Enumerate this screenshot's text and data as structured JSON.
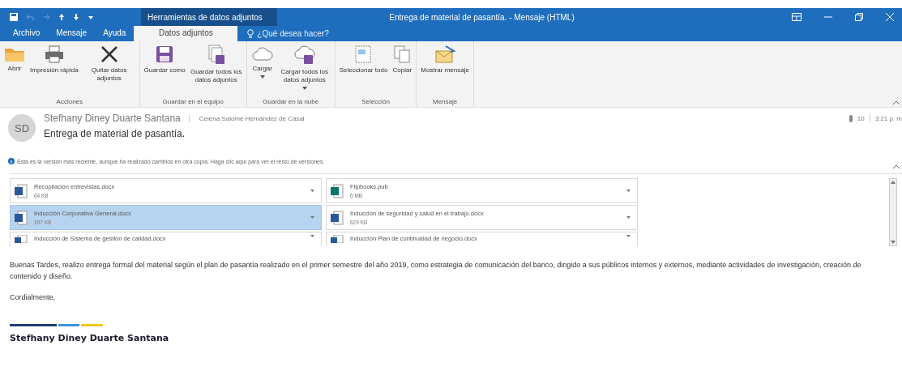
{
  "window": {
    "contextual_group": "Herramientas de datos adjuntos",
    "title": "Entrega de material de pasantía. - Mensaje (HTML)"
  },
  "tabs": [
    {
      "label": "Archivo",
      "selected": false
    },
    {
      "label": "Mensaje",
      "selected": false
    },
    {
      "label": "Ayuda",
      "selected": false
    },
    {
      "label": "Datos adjuntos",
      "selected": true
    }
  ],
  "tell_me": {
    "placeholder": "¿Qué desea hacer?"
  },
  "ribbon": [
    {
      "group": "Acciones",
      "buttons": [
        {
          "label": "Abrir"
        },
        {
          "label": "Impresión rápida"
        },
        {
          "label": "Quitar datos adjuntos"
        }
      ]
    },
    {
      "group": "Guardar en el equipo",
      "buttons": [
        {
          "label": "Guardar como"
        },
        {
          "label": "Guardar todos los datos adjuntos"
        }
      ]
    },
    {
      "group": "Guardar en la nube",
      "buttons": [
        {
          "label": "Cargar",
          "dropdown": true
        },
        {
          "label": "Cargar todos los datos adjuntos",
          "dropdown": true
        }
      ]
    },
    {
      "group": "Selección",
      "buttons": [
        {
          "label": "Seleccionar todo"
        },
        {
          "label": "Copiar"
        }
      ]
    },
    {
      "group": "Mensaje",
      "buttons": [
        {
          "label": "Mostrar mensaje"
        }
      ]
    }
  ],
  "message": {
    "avatar": "SD",
    "sender": "Stefhany Diney Duarte Santana",
    "recipient": "Celena Salomé Hernández de Casal",
    "subject": "Entrega de material de pasantía.",
    "count": "10",
    "time": "3:21 p. m",
    "info": "Esta es la versión más reciente, aunque ha realizado cambios en otra copia. Haga clic aquí para ver el resto de versiones."
  },
  "attachments": [
    {
      "name": "Recopilación entrevistas.docx",
      "size": "64 KB",
      "kind": "word",
      "selected": false
    },
    {
      "name": "Flipbooks.pub",
      "size": "6 MB",
      "kind": "publisher",
      "selected": false
    },
    {
      "name": "Inducción Corporativa General.docx",
      "size": "197 KB",
      "kind": "word",
      "selected": true
    },
    {
      "name": "Inducción de seguridad y salud en el trabajo.docx",
      "size": "629 KB",
      "kind": "word",
      "selected": false
    },
    {
      "name": "Inducción de Sistema de gestión de calidad.docx",
      "kind": "doc",
      "selected": false
    },
    {
      "name": "Inducción Plan de continuidad de negocio.docx",
      "kind": "doc",
      "selected": false
    }
  ],
  "body": {
    "paragraph": "Buenas Tardes, realizo entrega formal del material según el plan de pasantía realizado en el primer semestre del año 2019, como estrategia de comunicación del banco, dirigido a sus públicos internos y externos, mediante actividades de investigación, creación de contenido y diseño.",
    "closing": "Cordialmente,",
    "signature": "Stefhany Diney Duarte Santana"
  }
}
